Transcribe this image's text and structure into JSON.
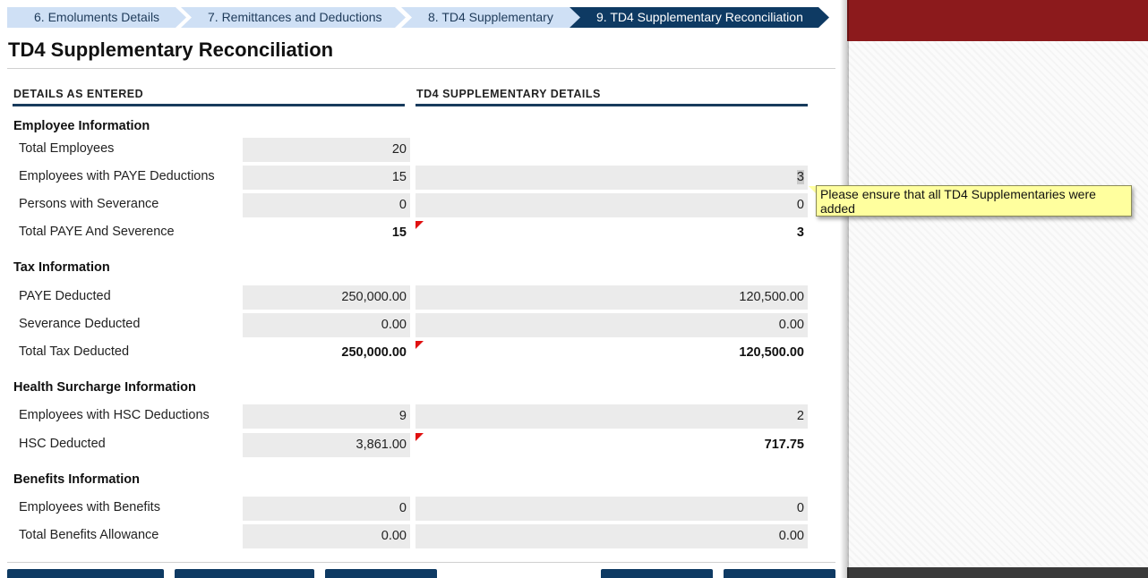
{
  "steps": [
    {
      "label": "6. Emoluments Details"
    },
    {
      "label": "7. Remittances and Deductions"
    },
    {
      "label": "8. TD4 Supplementary"
    },
    {
      "label": "9. TD4 Supplementary Reconciliation",
      "active": true
    }
  ],
  "title": "TD4 Supplementary Reconciliation",
  "columns": {
    "entered": "DETAILS AS ENTERED",
    "supplementary": "TD4 SUPPLEMENTARY DETAILS"
  },
  "sections": {
    "employee": {
      "title": "Employee Information",
      "total_employees": {
        "label": "Total Employees",
        "entered": "20"
      },
      "paye_employees": {
        "label": "Employees with PAYE Deductions",
        "entered": "15",
        "supp": "3"
      },
      "severance_persons": {
        "label": "Persons with Severance",
        "entered": "0",
        "supp": "0"
      },
      "total_paye_sev": {
        "label": "Total PAYE And Severence",
        "entered": "15",
        "supp": "3"
      }
    },
    "tax": {
      "title": "Tax Information",
      "paye_deducted": {
        "label": "PAYE Deducted",
        "entered": "250,000.00",
        "supp": "120,500.00"
      },
      "severance_deducted": {
        "label": "Severance Deducted",
        "entered": "0.00",
        "supp": "0.00"
      },
      "total_tax": {
        "label": "Total Tax Deducted",
        "entered": "250,000.00",
        "supp": "120,500.00"
      }
    },
    "health": {
      "title": "Health Surcharge Information",
      "hsc_employees": {
        "label": "Employees with HSC Deductions",
        "entered": "9",
        "supp": "2"
      },
      "hsc_deducted": {
        "label": "HSC Deducted",
        "entered": "3,861.00",
        "supp": "717.75"
      }
    },
    "benefits": {
      "title": "Benefits Information",
      "benefit_employees": {
        "label": "Employees with Benefits",
        "entered": "0",
        "supp": "0"
      },
      "benefits_allowance": {
        "label": "Total Benefits Allowance",
        "entered": "0.00",
        "supp": "0.00"
      }
    }
  },
  "tooltip": "Please ensure that all TD4 Supplementaries were added",
  "colors": {
    "accent": "#0e3a63",
    "step_inactive": "#cfe0f5",
    "flag": "#e01010",
    "tooltip_bg": "#ffff9e",
    "banner": "#8c1a1c"
  }
}
